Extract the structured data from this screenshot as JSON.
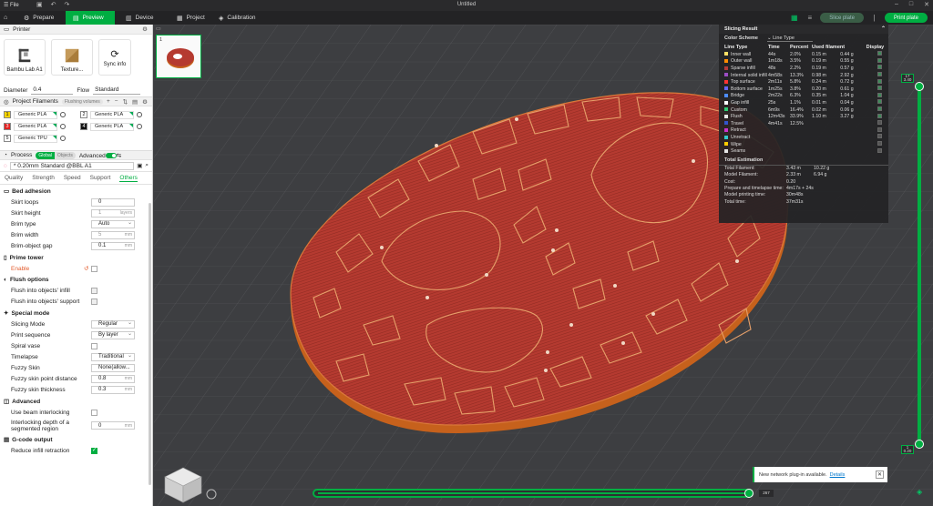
{
  "window": {
    "title": "Untitled",
    "file_menu": "File"
  },
  "tabs": [
    {
      "label": "Prepare"
    },
    {
      "label": "Preview"
    },
    {
      "label": "Device"
    },
    {
      "label": "Project"
    },
    {
      "label": "Calibration"
    }
  ],
  "actions": {
    "slice_plate": "Slice plate",
    "print_plate": "Print plate"
  },
  "printer": {
    "section_title": "Printer",
    "printer_name": "Bambu Lab A1",
    "plate_name": "Texture...",
    "sync_label": "Sync info",
    "diameter_label": "Diameter",
    "diameter_value": "0.4",
    "flow_label": "Flow",
    "flow_value": "Standard"
  },
  "filaments": {
    "section_title": "Project Filaments",
    "flushing_label": "Flushing volumes",
    "items": [
      {
        "num": "1",
        "name": "Generic PLA",
        "color": "#f5d400"
      },
      {
        "num": "2",
        "name": "Generic PLA",
        "color": "#ffffff"
      },
      {
        "num": "3",
        "name": "Generic PLA",
        "color": "#e32222"
      },
      {
        "num": "4",
        "name": "Generic PLA",
        "color": "#111111"
      },
      {
        "num": "5",
        "name": "Generic TPU",
        "color": "#ffffff"
      }
    ]
  },
  "process": {
    "section_title": "Process",
    "global_label": "Global",
    "objects_label": "Objects",
    "advanced_label": "Advanced",
    "profile": "* 0.20mm Standard @BBL A1",
    "tabs": [
      "Quality",
      "Strength",
      "Speed",
      "Support",
      "Others"
    ],
    "active_tab": "Others"
  },
  "settings": {
    "bed_adhesion": {
      "title": "Bed adhesion",
      "skirt_loops_label": "Skirt loops",
      "skirt_loops": "0",
      "skirt_height_label": "Skirt height",
      "skirt_height": "1",
      "skirt_height_unit": "layers",
      "brim_type_label": "Brim type",
      "brim_type": "Auto",
      "brim_width_label": "Brim width",
      "brim_width": "5",
      "brim_width_unit": "mm",
      "brim_gap_label": "Brim-object gap",
      "brim_gap": "0.1",
      "brim_gap_unit": "mm"
    },
    "prime_tower": {
      "title": "Prime tower",
      "enable_label": "Enable"
    },
    "flush_options": {
      "title": "Flush options",
      "infill_label": "Flush into objects' infill",
      "support_label": "Flush into objects' support"
    },
    "special_mode": {
      "title": "Special mode",
      "slicing_mode_label": "Slicing Mode",
      "slicing_mode": "Regular",
      "print_sequence_label": "Print sequence",
      "print_sequence": "By layer",
      "spiral_vase_label": "Spiral vase",
      "timelapse_label": "Timelapse",
      "timelapse": "Traditional",
      "fuzzy_skin_label": "Fuzzy Skin",
      "fuzzy_skin": "None(allow...",
      "fuzzy_dist_label": "Fuzzy skin point distance",
      "fuzzy_dist": "0.8",
      "fuzzy_dist_unit": "mm",
      "fuzzy_thick_label": "Fuzzy skin thickness",
      "fuzzy_thick": "0.3",
      "fuzzy_thick_unit": "mm"
    },
    "advanced": {
      "title": "Advanced",
      "beam_label": "Use beam interlocking",
      "depth_label_1": "Interlocking depth of a",
      "depth_label_2": "segmented region",
      "depth_value": "0",
      "depth_unit": "mm"
    },
    "gcode_output": {
      "title": "G-code output",
      "reduce_label": "Reduce infill retraction"
    }
  },
  "plate_index": "1",
  "slicing_result": {
    "title": "Slicing Result",
    "color_scheme_label": "Color Scheme",
    "color_scheme_value": "Line Type",
    "headers": {
      "line_type": "Line Type",
      "time": "Time",
      "percent": "Percent",
      "used": "Used filament",
      "display": "Display"
    },
    "rows": [
      {
        "name": "Inner wall",
        "time": "44s",
        "percent": "2.0%",
        "len": "0.15 m",
        "wt": "0.44 g",
        "color": "#ffe066",
        "on": true
      },
      {
        "name": "Outer wall",
        "time": "1m18s",
        "percent": "3.5%",
        "len": "0.19 m",
        "wt": "0.55 g",
        "color": "#ff8c00",
        "on": true
      },
      {
        "name": "Sparse infill",
        "time": "48s",
        "percent": "2.2%",
        "len": "0.19 m",
        "wt": "0.57 g",
        "color": "#b33b3b",
        "on": true
      },
      {
        "name": "Internal solid infill",
        "time": "4m58s",
        "percent": "13.3%",
        "len": "0.98 m",
        "wt": "2.92 g",
        "color": "#9c4dc4",
        "on": true
      },
      {
        "name": "Top surface",
        "time": "2m11s",
        "percent": "5.8%",
        "len": "0.24 m",
        "wt": "0.72 g",
        "color": "#ff3333",
        "on": true
      },
      {
        "name": "Bottom surface",
        "time": "1m25s",
        "percent": "3.8%",
        "len": "0.20 m",
        "wt": "0.61 g",
        "color": "#6666ff",
        "on": true
      },
      {
        "name": "Bridge",
        "time": "2m22s",
        "percent": "6.3%",
        "len": "0.35 m",
        "wt": "1.04 g",
        "color": "#4d8cff",
        "on": true
      },
      {
        "name": "Gap infill",
        "time": "25s",
        "percent": "1.1%",
        "len": "0.01 m",
        "wt": "0.04 g",
        "color": "#ffffff",
        "on": true
      },
      {
        "name": "Custom",
        "time": "6m9s",
        "percent": "16.4%",
        "len": "0.02 m",
        "wt": "0.06 g",
        "color": "#2ecc71",
        "on": true
      },
      {
        "name": "Flush",
        "time": "12m43s",
        "percent": "33.9%",
        "len": "1.10 m",
        "wt": "3.27 g",
        "color": "#e6e6e6",
        "on": true
      },
      {
        "name": "Travel",
        "time": "4m41s",
        "percent": "12.5%",
        "len": "",
        "wt": "",
        "color": "#3355cc",
        "on": false
      },
      {
        "name": "Retract",
        "time": "",
        "percent": "",
        "len": "",
        "wt": "",
        "color": "#cc33cc",
        "on": false
      },
      {
        "name": "Unretract",
        "time": "",
        "percent": "",
        "len": "",
        "wt": "",
        "color": "#33cccc",
        "on": false
      },
      {
        "name": "Wipe",
        "time": "",
        "percent": "",
        "len": "",
        "wt": "",
        "color": "#ffcc00",
        "on": false
      },
      {
        "name": "Seams",
        "time": "",
        "percent": "",
        "len": "",
        "wt": "",
        "color": "#e6e6e6",
        "on": false
      }
    ],
    "estimation_title": "Total Estimation",
    "estimation": [
      {
        "k": "Total Filament:",
        "v1": "3.43 m",
        "v2": "10.22 g"
      },
      {
        "k": "Model Filament:",
        "v1": "2.33 m",
        "v2": "6.94 g"
      },
      {
        "k": "Cost:",
        "v1": "0.20",
        "v2": ""
      },
      {
        "k": "Prepare and timelapse time:",
        "v1": "4m17s + 24s",
        "v2": ""
      },
      {
        "k": "Model printing time:",
        "v1": "30m48s",
        "v2": ""
      },
      {
        "k": "Total time:",
        "v1": "37m31s",
        "v2": ""
      }
    ]
  },
  "layer_slider": {
    "top_layer": "17",
    "top_height": "3.40",
    "bottom_layer": "1",
    "bottom_height": "0.20"
  },
  "move_slider": {
    "value": "267"
  },
  "notification": {
    "text": "New network plug-in available.",
    "link": "Details"
  },
  "colors": {
    "accent": "#00ae42",
    "model_red": "#b33b3b",
    "model_orange": "#d2691e"
  }
}
